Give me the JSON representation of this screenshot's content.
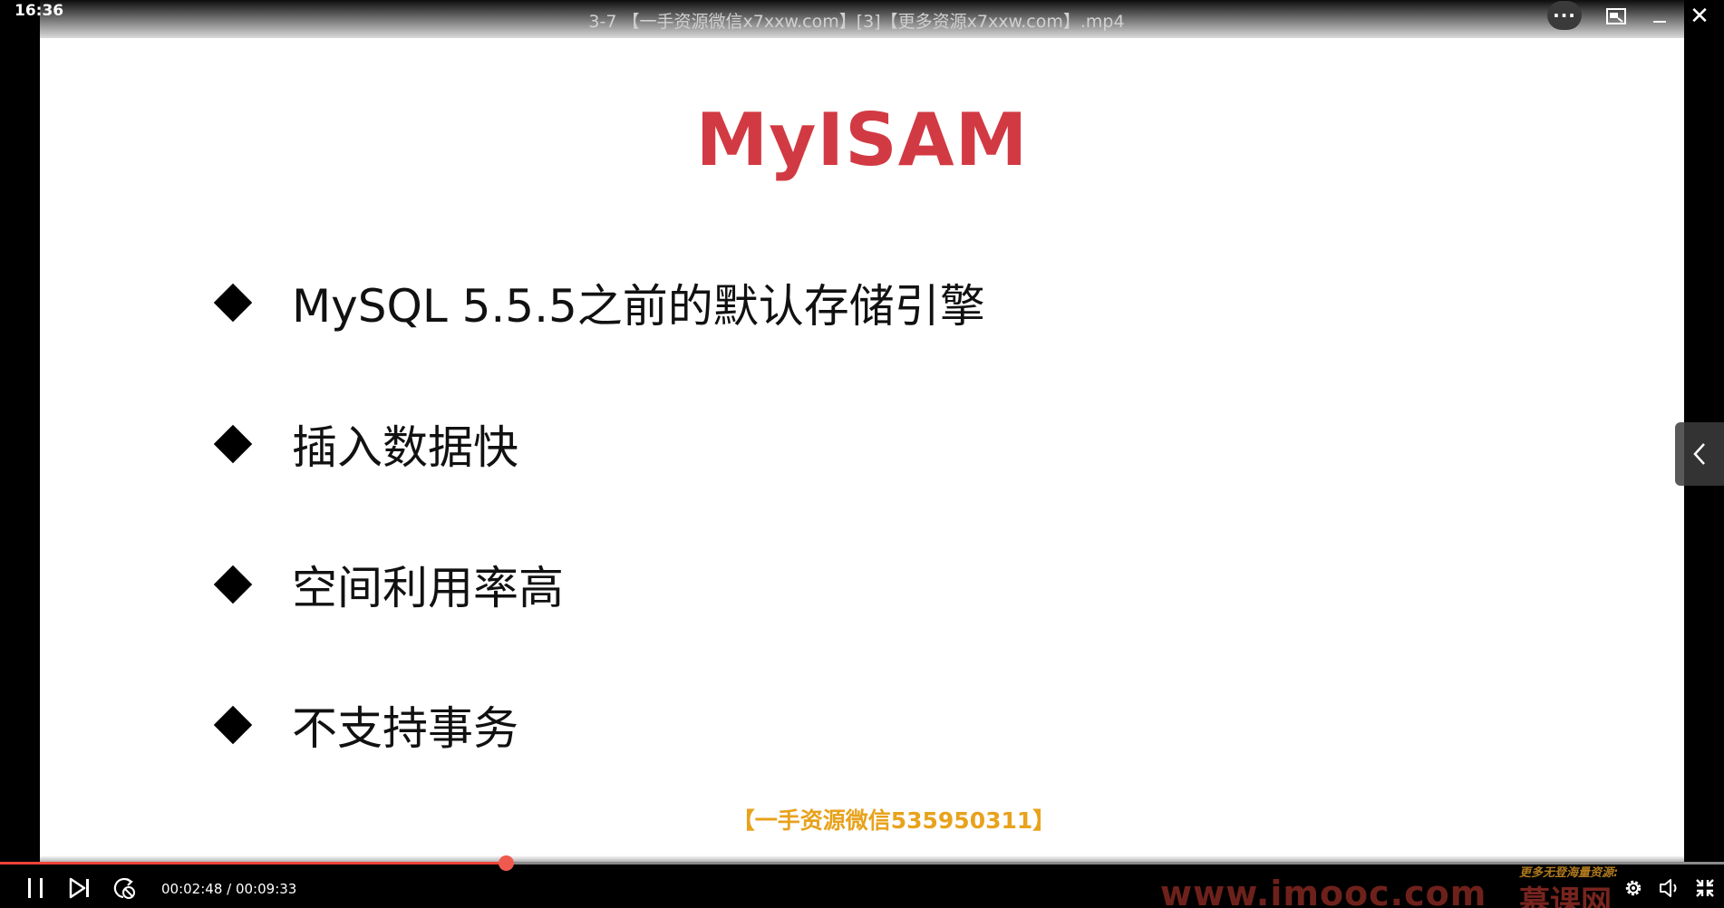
{
  "window": {
    "clock": "16:36",
    "video_title": "3-7 【一手资源微信x7xxw.com】[3]【更多资源x7xxw.com】.mp4",
    "more_label": "···",
    "close_label": "✕"
  },
  "slide": {
    "title": "MyISAM",
    "bullets": [
      "MySQL 5.5.5之前的默认存储引擎",
      "插入数据快",
      "空间利用率高",
      "不支持事务"
    ],
    "watermark_wechat": "【一手资源微信535950311】"
  },
  "controls": {
    "current_time": "00:02:48",
    "duration": "00:09:33",
    "time_separator": " / ",
    "progress_fraction": 0.2932
  },
  "watermarks": {
    "site": "www.imooc.com",
    "promo": "更多无登海量资源:",
    "logo": "慕课网"
  },
  "icons": {
    "pause": "pause-icon",
    "next": "skip-next-icon",
    "loop": "loop-icon",
    "settings": "gear-icon",
    "volume": "volume-icon",
    "exit_fullscreen": "exit-fullscreen-icon",
    "side_toggle": "chevron-left-icon"
  },
  "colors": {
    "title_red": "#d23a43",
    "progress": "#f04438",
    "wechat_watermark": "#e8a21c"
  }
}
